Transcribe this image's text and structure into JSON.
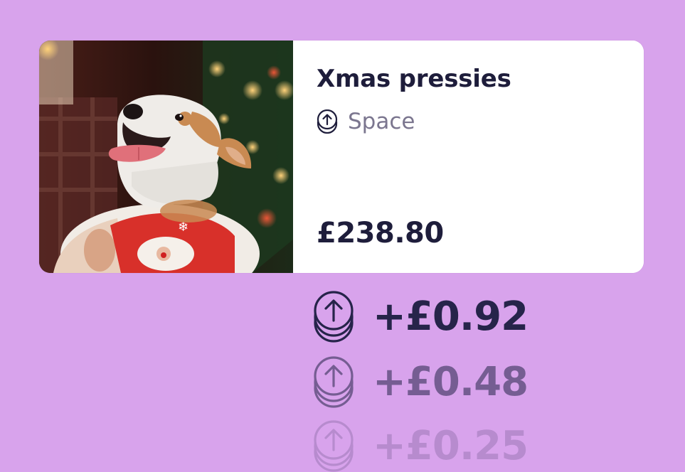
{
  "card": {
    "title": "Xmas pressies",
    "subtitle": "Space",
    "balance": "£238.80",
    "photo_icon": "festive-dog-photo",
    "space_icon": "coin-arrow-up-icon"
  },
  "increments": [
    {
      "amount": "+£0.92",
      "icon": "coin-arrow-up-icon"
    },
    {
      "amount": "+£0.48",
      "icon": "coin-arrow-up-icon"
    },
    {
      "amount": "+£0.25",
      "icon": "coin-arrow-up-icon"
    }
  ],
  "colors": {
    "background": "#d8a3ec",
    "card": "#ffffff",
    "text_primary": "#1e1d3b",
    "text_secondary": "#7b768f",
    "increment_text": "#26244a"
  }
}
